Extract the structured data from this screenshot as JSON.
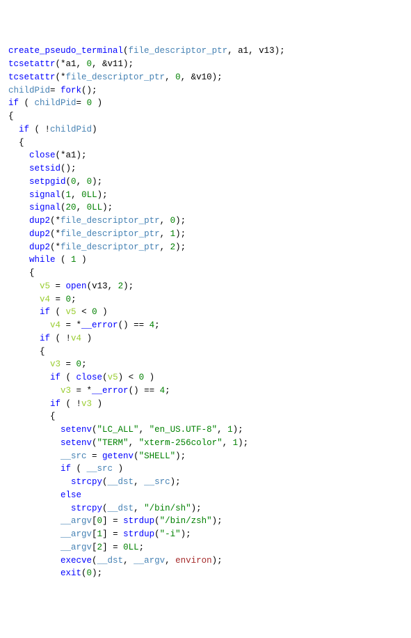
{
  "lines": [
    [
      [
        "fn",
        "create_pseudo_terminal"
      ],
      [
        "pn",
        "("
      ],
      [
        "id",
        "file_descriptor_ptr"
      ],
      [
        "pn",
        ", a1, v13);"
      ]
    ],
    [
      [
        "fn",
        "tcsetattr"
      ],
      [
        "pn",
        "(*a1, "
      ],
      [
        "nm",
        "0"
      ],
      [
        "pn",
        ", &v11);"
      ]
    ],
    [
      [
        "fn",
        "tcsetattr"
      ],
      [
        "pn",
        "(*"
      ],
      [
        "id",
        "file_descriptor_ptr"
      ],
      [
        "pn",
        ", "
      ],
      [
        "nm",
        "0"
      ],
      [
        "pn",
        ", &v10);"
      ]
    ],
    [
      [
        "id",
        "childPid"
      ],
      [
        "pn",
        "= "
      ],
      [
        "fn",
        "fork"
      ],
      [
        "pn",
        "();"
      ]
    ],
    [
      [
        "kw",
        "if"
      ],
      [
        "pn",
        " ( "
      ],
      [
        "id",
        "childPid"
      ],
      [
        "pn",
        "= "
      ],
      [
        "nm",
        "0"
      ],
      [
        "pn",
        " )"
      ]
    ],
    [
      [
        "pn",
        "{"
      ]
    ],
    [
      [
        "pn",
        "  "
      ],
      [
        "kw",
        "if"
      ],
      [
        "pn",
        " ( !"
      ],
      [
        "id",
        "childPid"
      ],
      [
        "pn",
        ")"
      ]
    ],
    [
      [
        "pn",
        "  {"
      ]
    ],
    [
      [
        "pn",
        "    "
      ],
      [
        "fn",
        "close"
      ],
      [
        "pn",
        "(*a1);"
      ]
    ],
    [
      [
        "pn",
        "    "
      ],
      [
        "fn",
        "setsid"
      ],
      [
        "pn",
        "();"
      ]
    ],
    [
      [
        "pn",
        "    "
      ],
      [
        "fn",
        "setpgid"
      ],
      [
        "pn",
        "("
      ],
      [
        "nm",
        "0"
      ],
      [
        "pn",
        ", "
      ],
      [
        "nm",
        "0"
      ],
      [
        "pn",
        ");"
      ]
    ],
    [
      [
        "pn",
        "    "
      ],
      [
        "fn",
        "signal"
      ],
      [
        "pn",
        "("
      ],
      [
        "nm",
        "1"
      ],
      [
        "pn",
        ", "
      ],
      [
        "nm",
        "0LL"
      ],
      [
        "pn",
        ");"
      ]
    ],
    [
      [
        "pn",
        "    "
      ],
      [
        "fn",
        "signal"
      ],
      [
        "pn",
        "("
      ],
      [
        "nm",
        "20"
      ],
      [
        "pn",
        ", "
      ],
      [
        "nm",
        "0LL"
      ],
      [
        "pn",
        ");"
      ]
    ],
    [
      [
        "pn",
        "    "
      ],
      [
        "fn",
        "dup2"
      ],
      [
        "pn",
        "(*"
      ],
      [
        "id",
        "file_descriptor_ptr"
      ],
      [
        "pn",
        ", "
      ],
      [
        "nm",
        "0"
      ],
      [
        "pn",
        ");"
      ]
    ],
    [
      [
        "pn",
        "    "
      ],
      [
        "fn",
        "dup2"
      ],
      [
        "pn",
        "(*"
      ],
      [
        "id",
        "file_descriptor_ptr"
      ],
      [
        "pn",
        ", "
      ],
      [
        "nm",
        "1"
      ],
      [
        "pn",
        ");"
      ]
    ],
    [
      [
        "pn",
        "    "
      ],
      [
        "fn",
        "dup2"
      ],
      [
        "pn",
        "(*"
      ],
      [
        "id",
        "file_descriptor_ptr"
      ],
      [
        "pn",
        ", "
      ],
      [
        "nm",
        "2"
      ],
      [
        "pn",
        ");"
      ]
    ],
    [
      [
        "pn",
        "    "
      ],
      [
        "kw",
        "while"
      ],
      [
        "pn",
        " ( "
      ],
      [
        "nm",
        "1"
      ],
      [
        "pn",
        " )"
      ]
    ],
    [
      [
        "pn",
        "    {"
      ]
    ],
    [
      [
        "pn",
        "      "
      ],
      [
        "lv",
        "v5"
      ],
      [
        "pn",
        " = "
      ],
      [
        "fn",
        "open"
      ],
      [
        "pn",
        "(v13, "
      ],
      [
        "nm",
        "2"
      ],
      [
        "pn",
        ");"
      ]
    ],
    [
      [
        "pn",
        "      "
      ],
      [
        "lv",
        "v4"
      ],
      [
        "pn",
        " = "
      ],
      [
        "nm",
        "0"
      ],
      [
        "pn",
        ";"
      ]
    ],
    [
      [
        "pn",
        "      "
      ],
      [
        "kw",
        "if"
      ],
      [
        "pn",
        " ( "
      ],
      [
        "lv",
        "v5"
      ],
      [
        "pn",
        " < "
      ],
      [
        "nm",
        "0"
      ],
      [
        "pn",
        " )"
      ]
    ],
    [
      [
        "pn",
        "        "
      ],
      [
        "lv",
        "v4"
      ],
      [
        "pn",
        " = *"
      ],
      [
        "fn",
        "__error"
      ],
      [
        "pn",
        "() == "
      ],
      [
        "nm",
        "4"
      ],
      [
        "pn",
        ";"
      ]
    ],
    [
      [
        "pn",
        "      "
      ],
      [
        "kw",
        "if"
      ],
      [
        "pn",
        " ( !"
      ],
      [
        "lv",
        "v4"
      ],
      [
        "pn",
        " )"
      ]
    ],
    [
      [
        "pn",
        "      {"
      ]
    ],
    [
      [
        "pn",
        "        "
      ],
      [
        "lv",
        "v3"
      ],
      [
        "pn",
        " = "
      ],
      [
        "nm",
        "0"
      ],
      [
        "pn",
        ";"
      ]
    ],
    [
      [
        "pn",
        "        "
      ],
      [
        "kw",
        "if"
      ],
      [
        "pn",
        " ( "
      ],
      [
        "fn",
        "close"
      ],
      [
        "pn",
        "("
      ],
      [
        "lv",
        "v5"
      ],
      [
        "pn",
        ") < "
      ],
      [
        "nm",
        "0"
      ],
      [
        "pn",
        " )"
      ]
    ],
    [
      [
        "pn",
        "          "
      ],
      [
        "lv",
        "v3"
      ],
      [
        "pn",
        " = *"
      ],
      [
        "fn",
        "__error"
      ],
      [
        "pn",
        "() == "
      ],
      [
        "nm",
        "4"
      ],
      [
        "pn",
        ";"
      ]
    ],
    [
      [
        "pn",
        "        "
      ],
      [
        "kw",
        "if"
      ],
      [
        "pn",
        " ( !"
      ],
      [
        "lv",
        "v3"
      ],
      [
        "pn",
        " )"
      ]
    ],
    [
      [
        "pn",
        "        {"
      ]
    ],
    [
      [
        "pn",
        "          "
      ],
      [
        "fn",
        "setenv"
      ],
      [
        "pn",
        "("
      ],
      [
        "st",
        "\"LC_ALL\""
      ],
      [
        "pn",
        ", "
      ],
      [
        "st",
        "\"en_US.UTF-8\""
      ],
      [
        "pn",
        ", "
      ],
      [
        "nm",
        "1"
      ],
      [
        "pn",
        ");"
      ]
    ],
    [
      [
        "pn",
        "          "
      ],
      [
        "fn",
        "setenv"
      ],
      [
        "pn",
        "("
      ],
      [
        "st",
        "\"TERM\""
      ],
      [
        "pn",
        ", "
      ],
      [
        "st",
        "\"xterm-256color\""
      ],
      [
        "pn",
        ", "
      ],
      [
        "nm",
        "1"
      ],
      [
        "pn",
        ");"
      ]
    ],
    [
      [
        "pn",
        "          "
      ],
      [
        "id",
        "__src"
      ],
      [
        "pn",
        " = "
      ],
      [
        "fn",
        "getenv"
      ],
      [
        "pn",
        "("
      ],
      [
        "st",
        "\"SHELL\""
      ],
      [
        "pn",
        ");"
      ]
    ],
    [
      [
        "pn",
        "          "
      ],
      [
        "kw",
        "if"
      ],
      [
        "pn",
        " ( "
      ],
      [
        "id",
        "__src"
      ],
      [
        "pn",
        " )"
      ]
    ],
    [
      [
        "pn",
        "            "
      ],
      [
        "fn",
        "strcpy"
      ],
      [
        "pn",
        "("
      ],
      [
        "id",
        "__dst"
      ],
      [
        "pn",
        ", "
      ],
      [
        "id",
        "__src"
      ],
      [
        "pn",
        ");"
      ]
    ],
    [
      [
        "pn",
        "          "
      ],
      [
        "kw",
        "else"
      ]
    ],
    [
      [
        "pn",
        "            "
      ],
      [
        "fn",
        "strcpy"
      ],
      [
        "pn",
        "("
      ],
      [
        "id",
        "__dst"
      ],
      [
        "pn",
        ", "
      ],
      [
        "st",
        "\"/bin/sh\""
      ],
      [
        "pn",
        ");"
      ]
    ],
    [
      [
        "pn",
        "          "
      ],
      [
        "id",
        "__argv"
      ],
      [
        "pn",
        "["
      ],
      [
        "nm",
        "0"
      ],
      [
        "pn",
        "] = "
      ],
      [
        "fn",
        "strdup"
      ],
      [
        "pn",
        "("
      ],
      [
        "st",
        "\"/bin/zsh\""
      ],
      [
        "pn",
        ");"
      ]
    ],
    [
      [
        "pn",
        "          "
      ],
      [
        "id",
        "__argv"
      ],
      [
        "pn",
        "["
      ],
      [
        "nm",
        "1"
      ],
      [
        "pn",
        "] = "
      ],
      [
        "fn",
        "strdup"
      ],
      [
        "pn",
        "("
      ],
      [
        "st",
        "\"-i\""
      ],
      [
        "pn",
        ");"
      ]
    ],
    [
      [
        "pn",
        "          "
      ],
      [
        "id",
        "__argv"
      ],
      [
        "pn",
        "["
      ],
      [
        "nm",
        "2"
      ],
      [
        "pn",
        "] = "
      ],
      [
        "nm",
        "0LL"
      ],
      [
        "pn",
        ";"
      ]
    ],
    [
      [
        "pn",
        "          "
      ],
      [
        "fn",
        "execve"
      ],
      [
        "pn",
        "("
      ],
      [
        "id",
        "__dst"
      ],
      [
        "pn",
        ", "
      ],
      [
        "id",
        "__argv"
      ],
      [
        "pn",
        ", "
      ],
      [
        "mv",
        "environ"
      ],
      [
        "pn",
        ");"
      ]
    ],
    [
      [
        "pn",
        "          "
      ],
      [
        "fn",
        "exit"
      ],
      [
        "pn",
        "("
      ],
      [
        "nm",
        "0"
      ],
      [
        "pn",
        ");"
      ]
    ]
  ]
}
